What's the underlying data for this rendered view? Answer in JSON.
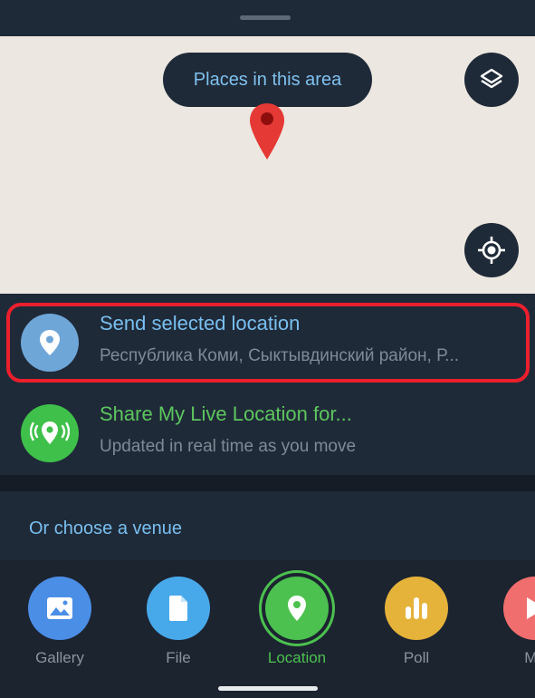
{
  "map": {
    "places_button": "Places in this area",
    "icons": {
      "pin": "map-pin-icon",
      "layers": "layers-icon",
      "locate": "my-location-icon"
    },
    "colors": {
      "map_bg": "#ece7e0",
      "pin": "#e53935"
    }
  },
  "selected_location": {
    "title": "Send selected location",
    "subtitle": "Республика Коми, Сыктывдинский район, Р...",
    "icon": "location-pin-icon",
    "highlight_color": "#ec1f2d"
  },
  "live_location": {
    "title": "Share My Live Location for...",
    "subtitle": "Updated in real time as you move",
    "icon": "live-location-icon"
  },
  "venues": {
    "label": "Or choose a venue"
  },
  "tabs": [
    {
      "label": "Gallery",
      "icon": "image-icon",
      "color": "#4b8ee6"
    },
    {
      "label": "File",
      "icon": "file-icon",
      "color": "#48a9ea"
    },
    {
      "label": "Location",
      "icon": "location-icon",
      "color": "#4cc14f",
      "active": true
    },
    {
      "label": "Poll",
      "icon": "poll-icon",
      "color": "#e5b23a"
    },
    {
      "label": "Mu",
      "icon": "music-icon",
      "color": "#f06e6e"
    }
  ]
}
